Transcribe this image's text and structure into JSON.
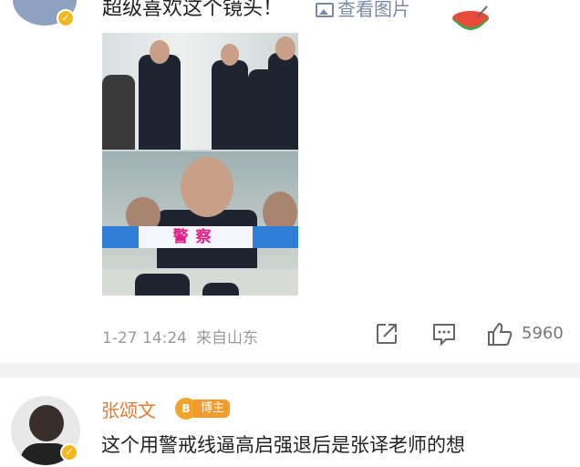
{
  "post": {
    "text": "超级喜欢这个镜头！",
    "view_images_label": "查看图片",
    "photo": {
      "tape_label": "警察"
    },
    "timestamp": "1-27 14:24",
    "source": "来自山东",
    "like_count": "5960"
  },
  "comment": {
    "username": "张颂文",
    "badge_label": "博主",
    "badge_icon_text": "B",
    "text": "这个用警戒线逼高启强退后是张译老师的想"
  },
  "colors": {
    "username": "#e07b30",
    "badge": "#f39a2c",
    "link": "#7a8aa6",
    "tape_blue": "#2f7fd6",
    "tape_text": "#e0208a"
  },
  "icons": [
    "verified-badge-icon",
    "picture-icon",
    "watermelon-emoji-icon",
    "share-icon",
    "comment-icon",
    "like-icon"
  ]
}
